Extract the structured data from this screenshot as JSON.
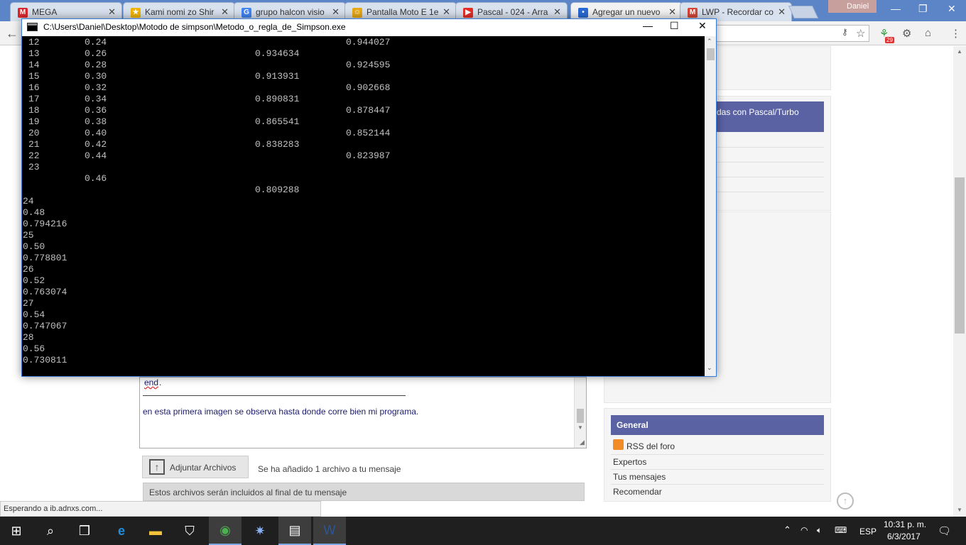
{
  "browser": {
    "tabs": [
      {
        "label": "MEGA",
        "fav": "M",
        "color": "#d9272e"
      },
      {
        "label": "Kami nomi zo Shir",
        "fav": "★",
        "color": "#f0b400"
      },
      {
        "label": "grupo halcon visio",
        "fav": "G",
        "color": "#4285f4"
      },
      {
        "label": "Pantalla Moto E 1e",
        "fav": "☺",
        "color": "#e6a817"
      },
      {
        "label": "Pascal - 024 - Arra",
        "fav": "▶",
        "color": "#e52d27"
      },
      {
        "label": "Agregar un nuevo",
        "fav": "•",
        "color": "#2a6ad3"
      },
      {
        "label": "LWP - Recordar co",
        "fav": "M",
        "color": "#d44638"
      }
    ],
    "profile_name": "Daniel",
    "status_text": "Esperando a ib.adnxs.com..."
  },
  "console": {
    "title": "C:\\Users\\Daniel\\Desktop\\Motodo de simpson\\Metodo_o_regla_de_Simpson.exe",
    "lines": [
      {
        "n": "12",
        "x": "0.24",
        "b": "",
        "c": "0.944027"
      },
      {
        "n": "13",
        "x": "0.26",
        "b": "0.934634",
        "c": ""
      },
      {
        "n": "14",
        "x": "0.28",
        "b": "",
        "c": "0.924595"
      },
      {
        "n": "15",
        "x": "0.30",
        "b": "0.913931",
        "c": ""
      },
      {
        "n": "16",
        "x": "0.32",
        "b": "",
        "c": "0.902668"
      },
      {
        "n": "17",
        "x": "0.34",
        "b": "0.890831",
        "c": ""
      },
      {
        "n": "18",
        "x": "0.36",
        "b": "",
        "c": "0.878447"
      },
      {
        "n": "19",
        "x": "0.38",
        "b": "0.865541",
        "c": ""
      },
      {
        "n": "20",
        "x": "0.40",
        "b": "",
        "c": "0.852144"
      },
      {
        "n": "21",
        "x": "0.42",
        "b": "0.838283",
        "c": ""
      },
      {
        "n": "22",
        "x": "0.44",
        "b": "",
        "c": "0.823987"
      },
      {
        "n": "23",
        "x": "",
        "b": "",
        "c": ""
      },
      {
        "n": "",
        "x": "0.46",
        "b": "",
        "c": ""
      },
      {
        "n": "",
        "x": "",
        "b": "0.809288",
        "c": ""
      }
    ],
    "tail_lines": [
      "24",
      "0.48",
      "0.794216",
      "25",
      "0.50",
      "0.778801",
      "26",
      "0.52",
      "0.763074",
      "27",
      "0.54",
      "0.747067",
      "28",
      "0.56",
      "0.730811"
    ]
  },
  "forum": {
    "sidebar_header_1": "das con Pascal/Turbo",
    "general_header": "General",
    "links": [
      "RSS del foro",
      "Expertos",
      "Tus mensajes",
      "Recomendar"
    ],
    "editor_code": "end",
    "editor_text": "en esta primera imagen se observa hasta donde corre bien  mi programa.",
    "attach_label": "Adjuntar Archivos",
    "attach_status": "Se ha añadido 1 archivo a tu mensaje",
    "info_text": "Estos archivos serán incluidos al final de tu mensaje"
  },
  "taskbar": {
    "lang": "ESP",
    "time": "10:31 p. m.",
    "date": "6/3/2017"
  }
}
